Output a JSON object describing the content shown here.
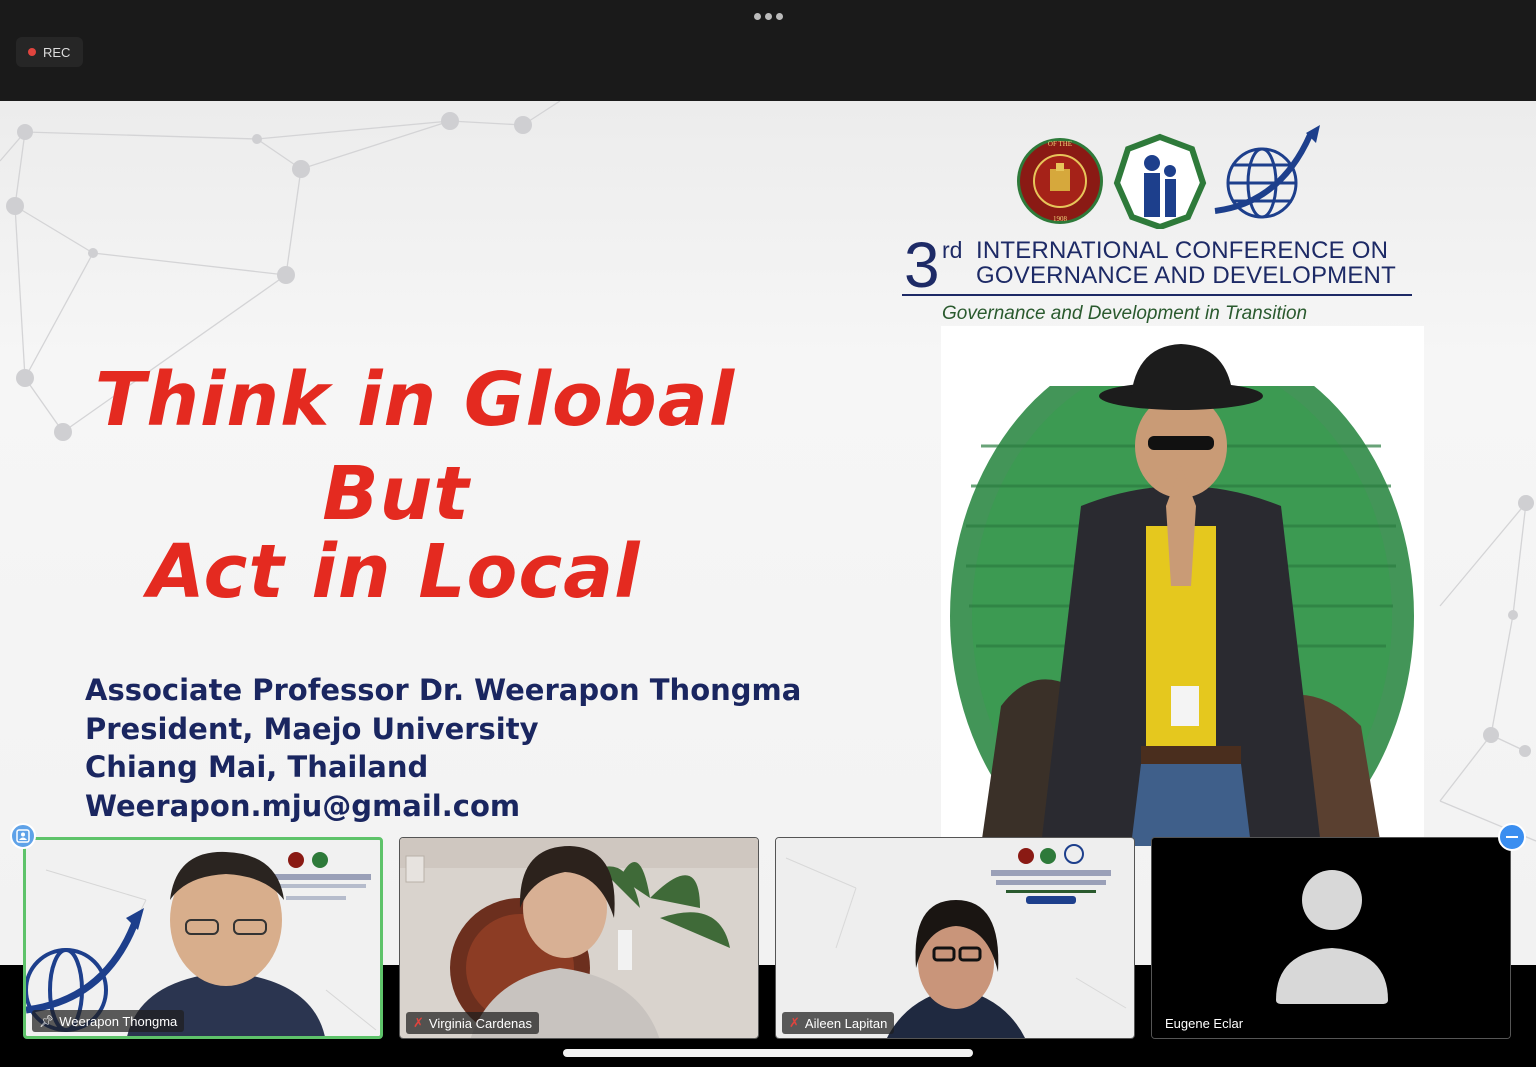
{
  "status": {
    "rec_label": "REC",
    "more_icon": "ellipsis-icon"
  },
  "slide": {
    "headline": [
      "Think in Global",
      "But",
      "Act in Local"
    ],
    "speaker": [
      "Associate Professor Dr. Weerapon Thongma",
      "President, Maejo University",
      "Chiang Mai, Thailand",
      "Weerapon.mju@gmail.com"
    ],
    "conference": {
      "number": "3",
      "ordinal_suffix": "rd",
      "title_line1": "INTERNATIONAL CONFERENCE ON",
      "title_line2": "GOVERNANCE AND DEVELOPMENT",
      "tagline": "Governance and Development in Transition"
    },
    "seal_text": {
      "top": "OF THE",
      "left": "UNIVERSITY",
      "right": "PHILIPPINES",
      "year": "1908"
    }
  },
  "participants": [
    {
      "name": "Weerapon Thongma",
      "status_icon": "pinned-icon",
      "active": true
    },
    {
      "name": "Virginia Cardenas",
      "status_icon": "muted-mic-icon",
      "active": false
    },
    {
      "name": "Aileen Lapitan",
      "status_icon": "muted-mic-icon",
      "active": false
    },
    {
      "name": "Eugene Eclar",
      "status_icon": "",
      "active": false
    }
  ],
  "colors": {
    "headline": "#e42a20",
    "navy": "#1a2660",
    "active_border": "#5ec36a",
    "rec_dot": "#e0443e"
  }
}
